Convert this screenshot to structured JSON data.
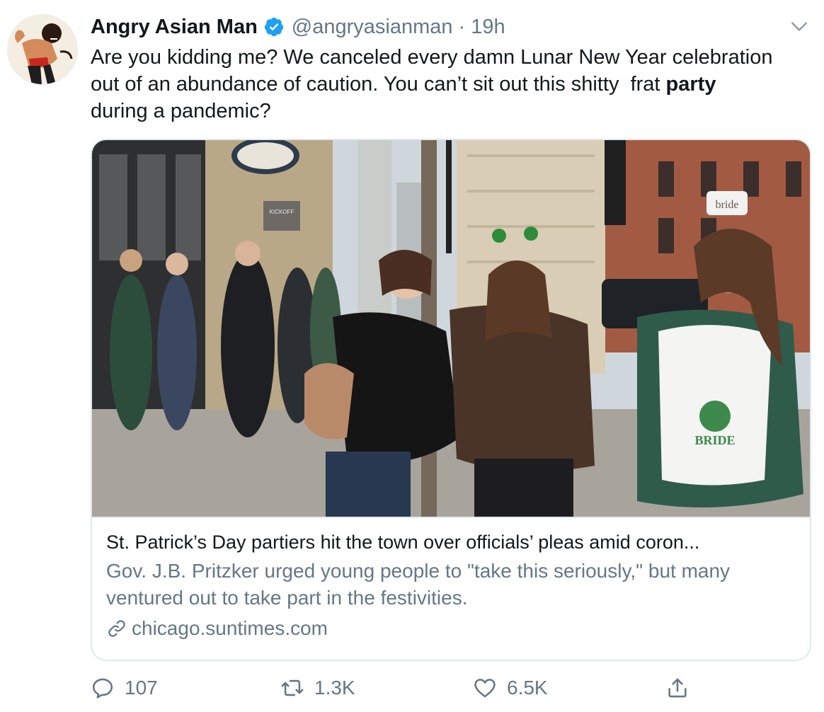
{
  "tweet": {
    "display_name": "Angry Asian Man",
    "handle": "@angryasianman",
    "separator": "·",
    "time": "19h",
    "text_line1": "Are you kidding me? We canceled every damn Lunar New Year celebration",
    "text_line2_pre": "out of an abundance of caution. You can’t sit out this shitty  frat ",
    "text_line2_bold": "party",
    "text_line3": "during a pandemic?"
  },
  "card": {
    "title": "St. Patrick’s Day partiers hit the town over officials’ pleas amid coron...",
    "description": "Gov. J.B. Pritzker urged young people to \"take this seriously,\" but many ventured out to take part in the festivities.",
    "domain": "chicago.suntimes.com",
    "photo_sign_text": "KICKOFF",
    "photo_shirt_text": "BRIDE",
    "photo_tiara_text": "bride"
  },
  "actions": {
    "replies": "107",
    "retweets": "1.3K",
    "likes": "6.5K"
  },
  "icons": {
    "verified": "verified-badge-icon",
    "caret": "chevron-down-icon",
    "link": "link-icon",
    "reply": "reply-icon",
    "retweet": "retweet-icon",
    "like": "heart-icon",
    "share": "share-icon"
  },
  "colors": {
    "text": "#14171a",
    "secondary": "#657786",
    "verified_blue": "#1da1f2",
    "border": "#e1e8ed"
  }
}
